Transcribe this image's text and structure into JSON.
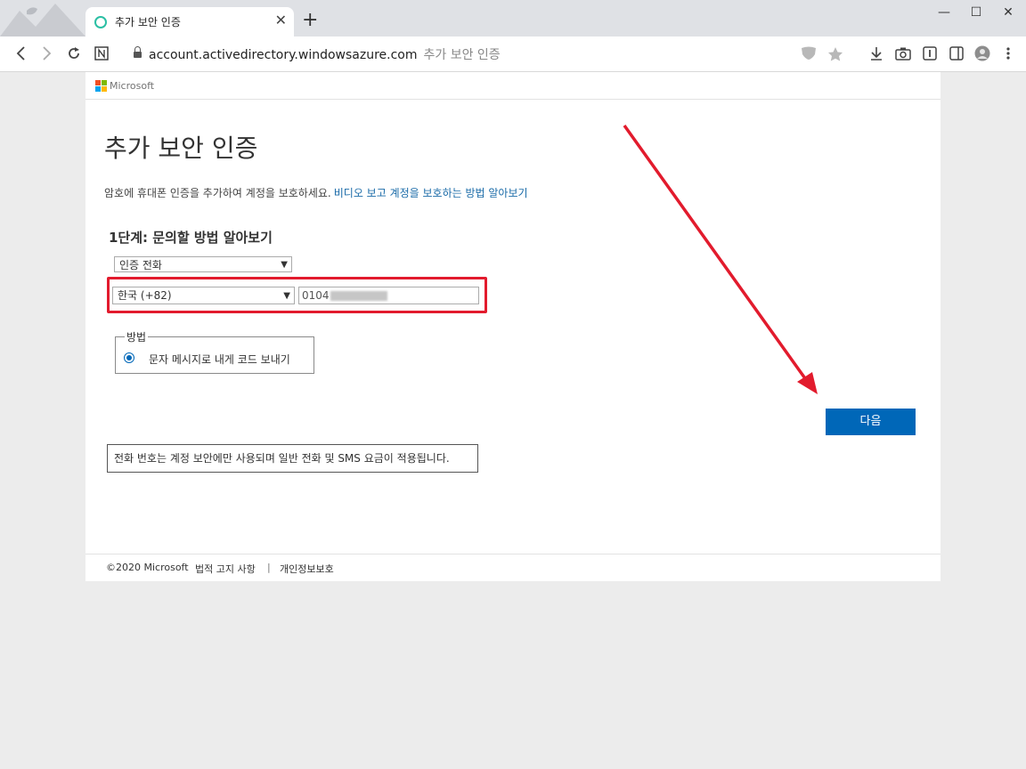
{
  "browser": {
    "tab_title": "추가 보안 인증",
    "tab_close": "✕",
    "new_tab": "+",
    "window_controls": {
      "minimize": "—",
      "maximize": "☐",
      "close": "✕"
    },
    "address_host": "account.activedirectory.windowsazure.com",
    "address_title": "추가 보안 인증"
  },
  "header": {
    "brand": "Microsoft"
  },
  "main": {
    "title": "추가 보안 인증",
    "intro_text": "암호에 휴대폰 인증을 추가하여 계정을 보호하세요.",
    "intro_link": "비디오 보고 계정을 보호하는 방법 알아보기",
    "step_heading": "1단계: 문의할 방법 알아보기",
    "method_select": "인증 전화",
    "country_select": "한국 (+82)",
    "phone_value": "0104",
    "method_legend": "방법",
    "radio_label": "문자 메시지로 내게 코드 보내기",
    "next_button": "다음",
    "notice": "전화 번호는 계정 보안에만 사용되며 일반 전화 및 SMS 요금이 적용됩니다."
  },
  "footer": {
    "copyright": "©2020 Microsoft",
    "legal": "법적 고지 사항",
    "separator": "|",
    "privacy": "개인정보보호"
  },
  "colors": {
    "accent": "#0067b8",
    "link": "#1a6ba8",
    "annotation_red": "#e21b2d",
    "logo": [
      "#f25022",
      "#7fba00",
      "#00a4ef",
      "#ffb900"
    ]
  }
}
